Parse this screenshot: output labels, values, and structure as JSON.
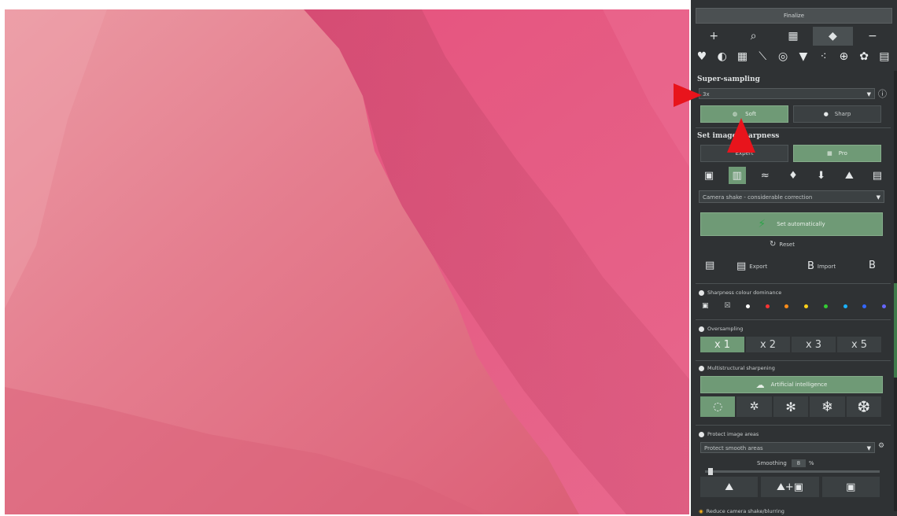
{
  "panel": {
    "finalize_label": "Finalize",
    "tools": [
      "+",
      "⌕",
      "▦",
      "◆",
      "−"
    ],
    "icon_strip": [
      "♥",
      "◐",
      "▦",
      "⟍",
      "◎",
      "▼",
      "⁖",
      "⊕",
      "✿",
      "▤"
    ],
    "supersampling": {
      "heading": "Super-sampling",
      "select_value": "3x",
      "info_icon": "ⓘ",
      "soft_label": "Soft",
      "sharp_label": "Sharp"
    },
    "sharpness": {
      "heading": "Set image sharpness",
      "expert_label": "Expert",
      "pro_label": "Pro",
      "preset_icons": [
        "▣",
        "▥",
        "≈",
        "♦",
        "⬇",
        "⛰",
        "▤"
      ],
      "preset_value": "Camera shake - considerable correction",
      "auto_label": "Set automatically",
      "reset_label": "Reset",
      "export_label": "Export",
      "import_label": "Import"
    },
    "colour_dominance": {
      "label": "Sharpness colour dominance",
      "dot_colors": [
        "#ffffff",
        "#ff3333",
        "#ff8c1a",
        "#ffd11a",
        "#33cc33",
        "#1ab2ff",
        "#3366ff",
        "#6666ff"
      ]
    },
    "oversampling": {
      "label": "Oversampling",
      "options": [
        "x 1",
        "x 2",
        "x 3",
        "x 5"
      ],
      "selected_index": 0
    },
    "multistructural": {
      "label": "Multistructural sharpening",
      "ai_label": "Artificial intelligence",
      "options": [
        "◌",
        "✲",
        "✻",
        "❄",
        "❆"
      ]
    },
    "protect": {
      "label": "Protect image areas",
      "select_value": "Protect smooth areas",
      "smoothing_label": "Smoothing",
      "smoothing_value": "8",
      "smoothing_unit": "%"
    },
    "reduce_label": "Reduce camera shake/blurring"
  }
}
